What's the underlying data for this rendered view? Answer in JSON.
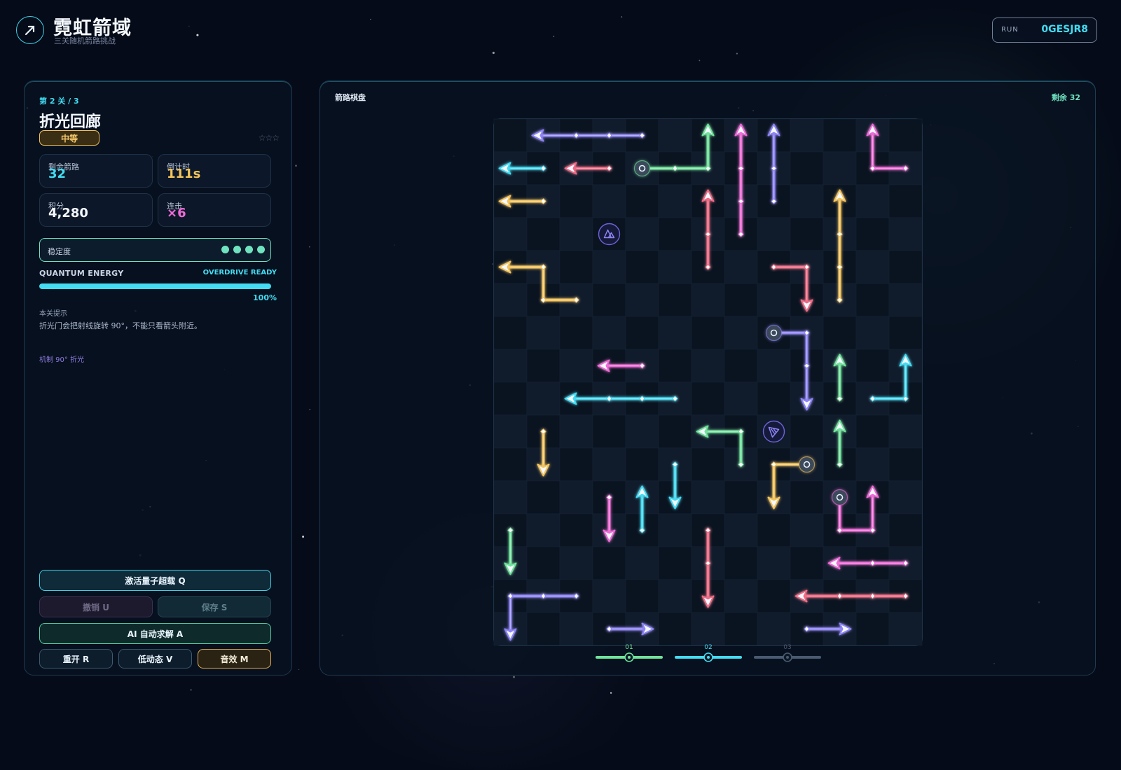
{
  "header": {
    "title": "霓虹箭域",
    "subtitle": "三关随机箭路挑战",
    "run_label": "RUN",
    "run_code": "0GESJR8"
  },
  "level": {
    "label": "第 2 关 / 3",
    "name": "折光回廊",
    "difficulty": "中等",
    "stars": "☆☆☆",
    "stats": {
      "remaining": {
        "label": "剩余箭路",
        "value": "32"
      },
      "timer": {
        "label": "倒计时",
        "value": "111s"
      },
      "score": {
        "label": "积分",
        "value": "4,280"
      },
      "combo": {
        "label": "连击",
        "value": "×6"
      }
    },
    "stability": {
      "label": "稳定度",
      "pips": 4
    },
    "energy": {
      "label": "QUANTUM ENERGY",
      "state": "OVERDRIVE READY",
      "percent": "100%",
      "fraction": 1.0
    },
    "hint": {
      "title": "本关提示",
      "text": "折光门会把射线旋转 90°，不能只看箭头附近。"
    },
    "mechanic": "机制  90° 折光"
  },
  "buttons": {
    "quantum": "激活量子超载  Q",
    "undo": "撤销  U",
    "save": "保存  S",
    "ai": "AI 自动求解  A",
    "restart": "重开 R",
    "low_motion": "低动态 V",
    "sound": "音效 M"
  },
  "board": {
    "title": "箭路棋盘",
    "remaining": "剩余 32",
    "cols": 13,
    "rows": 16,
    "colors": {
      "cyan": "#43dcf2",
      "green": "#6fe39a",
      "pink": "#f06ad8",
      "purple": "#8f84f6",
      "yellow": "#f5c45a",
      "red": "#f06a84"
    },
    "arrows": [
      {
        "color": "purple",
        "cells": [
          [
            4,
            0
          ],
          [
            3,
            0
          ],
          [
            2,
            0
          ],
          [
            1,
            0
          ]
        ]
      },
      {
        "color": "cyan",
        "cells": [
          [
            1,
            1
          ],
          [
            0,
            1
          ]
        ]
      },
      {
        "color": "red",
        "cells": [
          [
            3,
            1
          ],
          [
            2,
            1
          ]
        ]
      },
      {
        "color": "green",
        "cells": [
          [
            4,
            1
          ],
          [
            5,
            1
          ],
          [
            6,
            1
          ],
          [
            6,
            0
          ]
        ],
        "start_node": true
      },
      {
        "color": "pink",
        "cells": [
          [
            7,
            3
          ],
          [
            7,
            2
          ],
          [
            7,
            1
          ],
          [
            7,
            0
          ]
        ]
      },
      {
        "color": "purple",
        "cells": [
          [
            8,
            2
          ],
          [
            8,
            1
          ],
          [
            8,
            0
          ]
        ]
      },
      {
        "color": "pink",
        "cells": [
          [
            12,
            1
          ],
          [
            11,
            1
          ],
          [
            11,
            0
          ]
        ]
      },
      {
        "color": "yellow",
        "cells": [
          [
            1,
            2
          ],
          [
            0,
            2
          ]
        ]
      },
      {
        "color": "red",
        "cells": [
          [
            6,
            4
          ],
          [
            6,
            3
          ],
          [
            6,
            2
          ]
        ]
      },
      {
        "color": "yellow",
        "cells": [
          [
            10,
            5
          ],
          [
            10,
            4
          ],
          [
            10,
            3
          ],
          [
            10,
            2
          ]
        ]
      },
      {
        "color": "yellow",
        "cells": [
          [
            2,
            5
          ],
          [
            1,
            5
          ],
          [
            1,
            4
          ],
          [
            0,
            4
          ]
        ]
      },
      {
        "color": "red",
        "cells": [
          [
            8,
            4
          ],
          [
            9,
            4
          ],
          [
            9,
            5
          ]
        ]
      },
      {
        "color": "purple",
        "cells": [
          [
            8,
            6
          ],
          [
            9,
            6
          ],
          [
            9,
            7
          ],
          [
            9,
            8
          ]
        ],
        "start_node": true
      },
      {
        "color": "pink",
        "cells": [
          [
            4,
            7
          ],
          [
            3,
            7
          ]
        ]
      },
      {
        "color": "green",
        "cells": [
          [
            10,
            8
          ],
          [
            10,
            7
          ]
        ]
      },
      {
        "color": "cyan",
        "cells": [
          [
            11,
            8
          ],
          [
            12,
            8
          ],
          [
            12,
            7
          ]
        ]
      },
      {
        "color": "cyan",
        "cells": [
          [
            5,
            8
          ],
          [
            4,
            8
          ],
          [
            3,
            8
          ],
          [
            2,
            8
          ]
        ]
      },
      {
        "color": "green",
        "cells": [
          [
            7,
            10
          ],
          [
            7,
            9
          ],
          [
            6,
            9
          ]
        ]
      },
      {
        "color": "green",
        "cells": [
          [
            10,
            10
          ],
          [
            10,
            9
          ]
        ]
      },
      {
        "color": "yellow",
        "cells": [
          [
            1,
            9
          ],
          [
            1,
            10
          ]
        ]
      },
      {
        "color": "yellow",
        "cells": [
          [
            9,
            10
          ],
          [
            8,
            10
          ],
          [
            8,
            11
          ]
        ],
        "start_node": true
      },
      {
        "color": "cyan",
        "cells": [
          [
            5,
            10
          ],
          [
            5,
            11
          ]
        ]
      },
      {
        "color": "cyan",
        "cells": [
          [
            4,
            12
          ],
          [
            4,
            11
          ]
        ]
      },
      {
        "color": "pink",
        "cells": [
          [
            3,
            11
          ],
          [
            3,
            12
          ]
        ]
      },
      {
        "color": "pink",
        "cells": [
          [
            10,
            11
          ],
          [
            10,
            12
          ],
          [
            11,
            12
          ],
          [
            11,
            11
          ]
        ],
        "start_node": true
      },
      {
        "color": "green",
        "cells": [
          [
            0,
            12
          ],
          [
            0,
            13
          ]
        ]
      },
      {
        "color": "red",
        "cells": [
          [
            6,
            12
          ],
          [
            6,
            13
          ],
          [
            6,
            14
          ]
        ]
      },
      {
        "color": "pink",
        "cells": [
          [
            12,
            13
          ],
          [
            11,
            13
          ],
          [
            10,
            13
          ]
        ]
      },
      {
        "color": "purple",
        "cells": [
          [
            2,
            14
          ],
          [
            1,
            14
          ],
          [
            0,
            14
          ],
          [
            0,
            15
          ]
        ]
      },
      {
        "color": "red",
        "cells": [
          [
            12,
            14
          ],
          [
            11,
            14
          ],
          [
            10,
            14
          ],
          [
            9,
            14
          ]
        ]
      },
      {
        "color": "purple",
        "cells": [
          [
            3,
            15
          ],
          [
            4,
            15
          ]
        ]
      },
      {
        "color": "purple",
        "cells": [
          [
            9,
            15
          ],
          [
            10,
            15
          ]
        ]
      }
    ],
    "portals": [
      {
        "cell": [
          3,
          3
        ],
        "icon": "prism-icon"
      },
      {
        "cell": [
          8,
          9
        ],
        "icon": "refract-icon"
      }
    ],
    "stages": [
      {
        "label": "01",
        "color": "#6fe39a"
      },
      {
        "label": "02",
        "color": "#43dcf2"
      },
      {
        "label": "03",
        "color": "#4a5a70"
      }
    ]
  }
}
